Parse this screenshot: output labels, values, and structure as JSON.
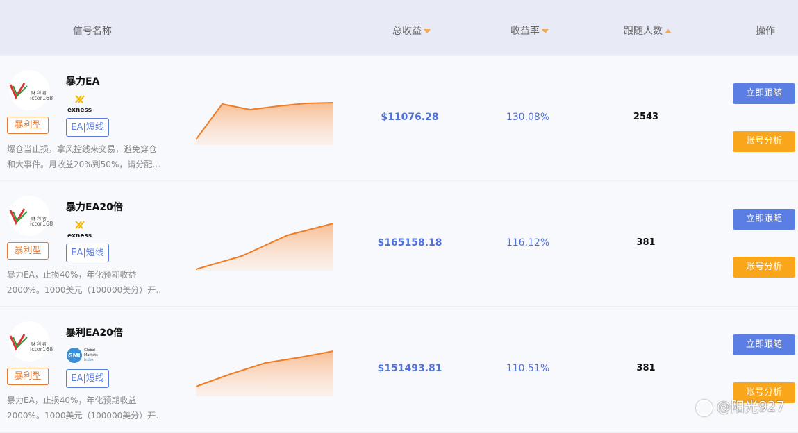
{
  "header": {
    "signal_name": "信号名称",
    "total_profit": "总收益",
    "profit_rate": "收益率",
    "followers": "跟随人数",
    "actions": "操作"
  },
  "logo": {
    "brand_cn": "财 利 者",
    "brand_en": "ictor168"
  },
  "rows": [
    {
      "name": "暴力EA",
      "broker": "exness",
      "type": "暴利型",
      "tag": "EA|短线",
      "desc1": "爆仓当止损，拿风控线来交易，避免穿仓",
      "desc2": "和大事件。月收益20%到50%，请分配…",
      "profit": "$11076.28",
      "rate": "130.08%",
      "followers": "2543",
      "follow_btn": "立即跟随",
      "analysis_btn": "账号分析"
    },
    {
      "name": "暴力EA20倍",
      "broker": "exness",
      "type": "暴利型",
      "tag": "EA|短线",
      "desc1": "暴力EA，止损40%，年化预期收益",
      "desc2": "2000%。1000美元（100000美分）开…",
      "profit": "$165158.18",
      "rate": "116.12%",
      "followers": "381",
      "follow_btn": "立即跟随",
      "analysis_btn": "账号分析"
    },
    {
      "name": "暴利EA20倍",
      "broker": "GMI",
      "broker_sub1": "Global",
      "broker_sub2": "Markets",
      "broker_sub3": "Index",
      "type": "暴利型",
      "tag": "EA|短线",
      "desc1": "暴力EA，止损40%，年化预期收益",
      "desc2": "2000%。1000美元（100000美分）开…",
      "profit": "$151493.81",
      "rate": "110.51%",
      "followers": "381",
      "follow_btn": "立即跟随",
      "analysis_btn": "账号分析"
    }
  ],
  "watermark": "@阳光927",
  "colors": {
    "accent_blue": "#5b7ee5",
    "orange": "#faa61a",
    "line": "#f07c24"
  }
}
